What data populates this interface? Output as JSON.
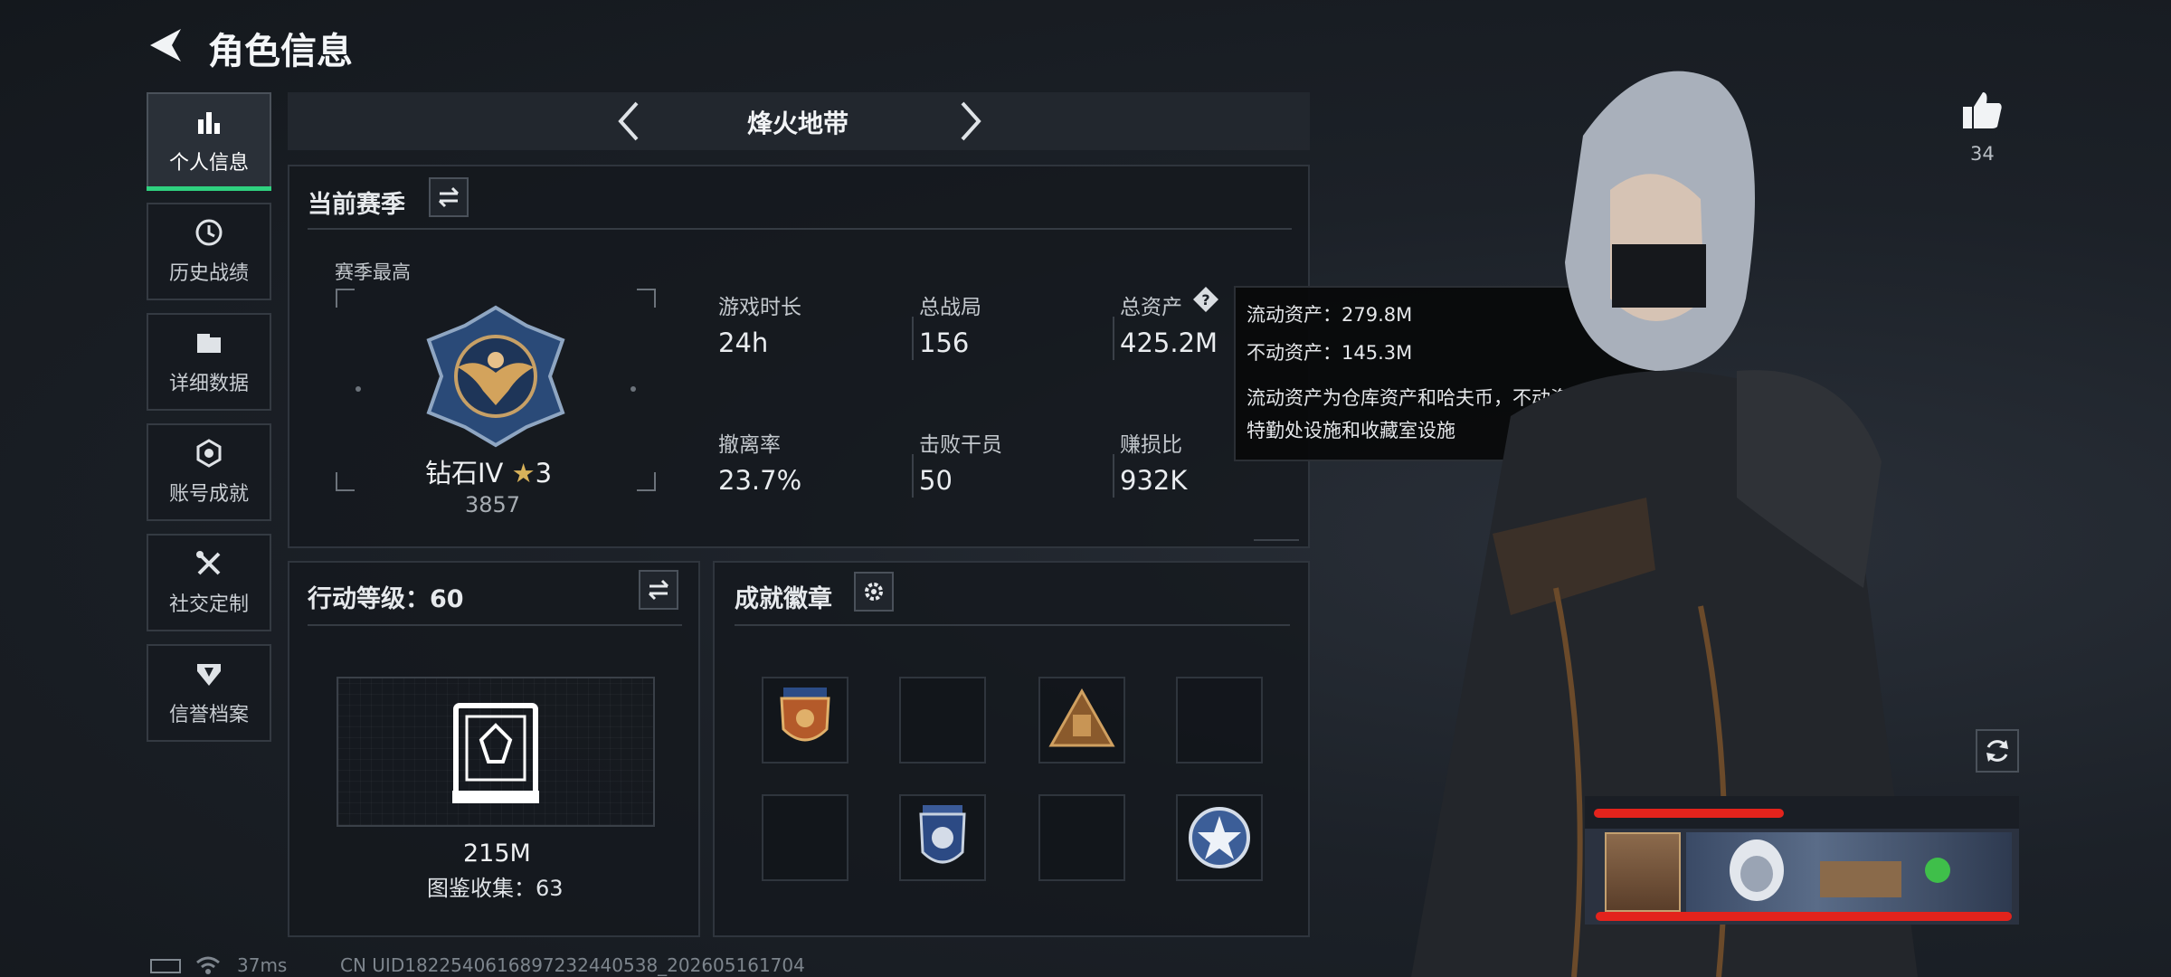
{
  "header": {
    "title": "角色信息"
  },
  "sidebar": {
    "items": [
      {
        "label": "个人信息",
        "icon": "bar-chart-icon"
      },
      {
        "label": "历史战绩",
        "icon": "clock-icon"
      },
      {
        "label": "详细数据",
        "icon": "folder-icon"
      },
      {
        "label": "账号成就",
        "icon": "medal-icon"
      },
      {
        "label": "社交定制",
        "icon": "tools-icon"
      },
      {
        "label": "信誉档案",
        "icon": "shield-badge-icon"
      }
    ]
  },
  "mode_selector": {
    "label": "烽火地带"
  },
  "season": {
    "title": "当前赛季",
    "highest_label": "赛季最高",
    "rank_name": "钻石IV",
    "rank_stars": "3",
    "rank_score": "3857",
    "stats": [
      {
        "label": "游戏时长",
        "value": "24h"
      },
      {
        "label": "总战局",
        "value": "156"
      },
      {
        "label": "总资产",
        "value": "425.2M"
      },
      {
        "label": "撤离率",
        "value": "23.7%"
      },
      {
        "label": "击败干员",
        "value": "50"
      },
      {
        "label": "赚损比",
        "value": "932K"
      }
    ]
  },
  "tooltip": {
    "line1": "流动资产：279.8M",
    "line2": "不动资产：145.3M",
    "line3": "流动资产为仓库资产和哈夫币，不动资产为",
    "line4": "特勤处设施和收藏室设施"
  },
  "action_level": {
    "title": "行动等级：60",
    "value": "215M",
    "collection": "图鉴收集：63"
  },
  "badges": {
    "title": "成就徽章"
  },
  "likes": {
    "count": "34"
  },
  "status_bar": {
    "ping": "37ms",
    "uid": "CN UID1822540616897232440538_202605161704"
  },
  "colors": {
    "accent": "#2fd17f",
    "redline": "#e3231c"
  }
}
